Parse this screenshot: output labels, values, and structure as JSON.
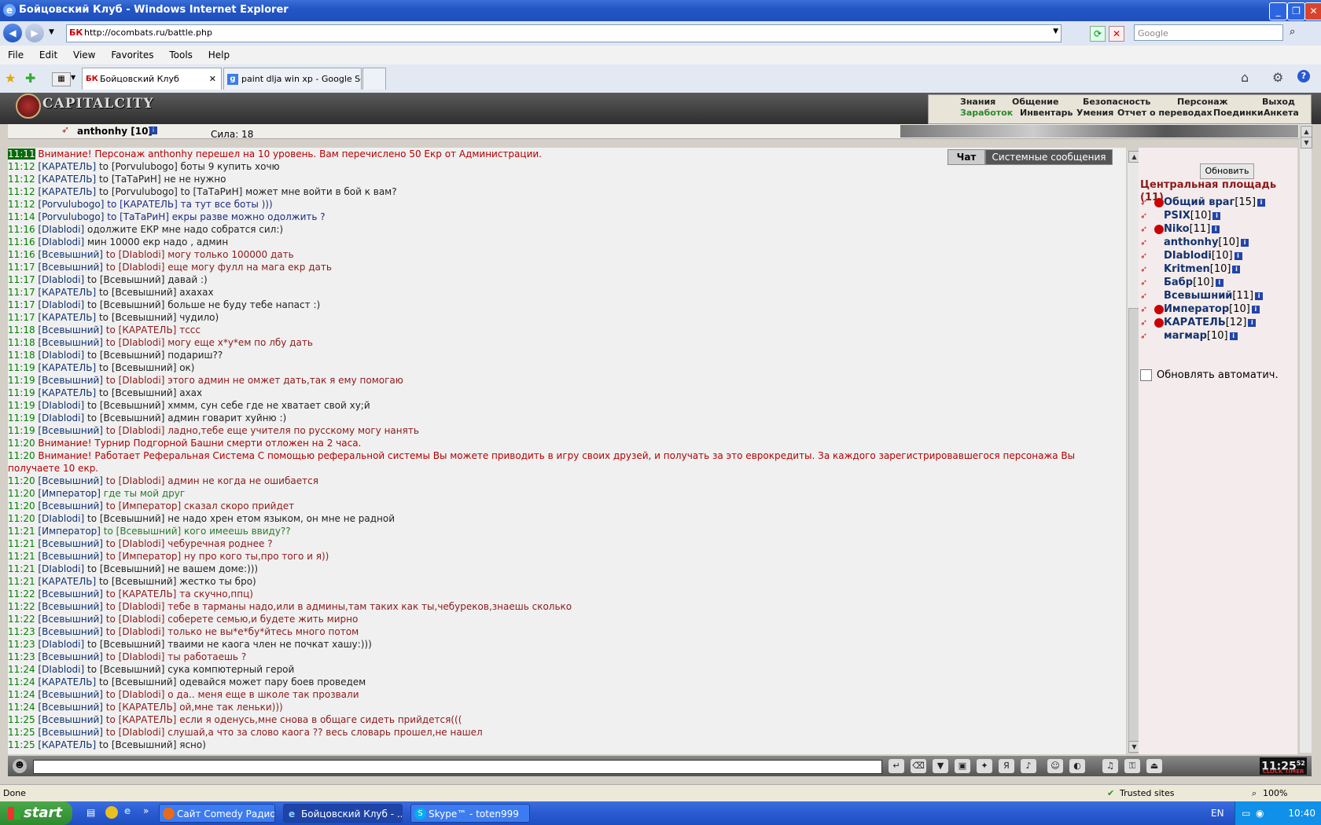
{
  "window": {
    "title": "Бойцовский Клуб - Windows Internet Explorer",
    "ie_icon": "ie-e-icon"
  },
  "address": {
    "url": "http://ocombats.ru/battle.php",
    "search_placeholder": "Google",
    "favicon": "БК"
  },
  "menu": [
    "File",
    "Edit",
    "View",
    "Favorites",
    "Tools",
    "Help"
  ],
  "tabs": [
    {
      "label": "Бойцовский Клуб",
      "icon": "БК"
    },
    {
      "label": "paint dlja win xp - Google Se...",
      "icon": "g"
    }
  ],
  "game": {
    "logo": "CAPITALCITY",
    "nav_top": [
      "Знания",
      "Общение",
      "Безопасность",
      "Персонаж",
      "Выход"
    ],
    "nav_bottom": [
      "Заработок",
      "Инвентарь",
      "Умения",
      "Отчет о переводах",
      "Поединки",
      "Анкета"
    ],
    "character": {
      "name": "anthonhy [10]",
      "stat": "Сила: 18"
    }
  },
  "chat": {
    "tab_chat": "Чат",
    "tab_system": "Системные сообщения",
    "lines": [
      {
        "time": "11:11",
        "speaker": "",
        "target": "",
        "text": "Внимание! Персонаж anthonhy перешел на 10 уровень. Вам перечислено 50 Екр от Администрации.",
        "cls": "sys",
        "hl": true
      },
      {
        "time": "11:12",
        "speaker": "[КАРАТЕЛЬ]",
        "target": "to [Porvulubogo]",
        "text": "боты 9 купить хочю",
        "cls": "to"
      },
      {
        "time": "11:12",
        "speaker": "[КАРАТЕЛЬ]",
        "target": "to [ТаТаРиН]",
        "text": "не не нужно",
        "cls": "to"
      },
      {
        "time": "11:12",
        "speaker": "[КАРАТЕЛЬ]",
        "target": "to [Porvulubogo] to [ТаТаРиН]",
        "text": "может мне войти в бой к вам?",
        "cls": "to"
      },
      {
        "time": "11:12",
        "speaker": "[Porvulubogo]",
        "target": "to [КАРАТЕЛЬ]",
        "text": "та тут все боты )))",
        "cls": "bl"
      },
      {
        "time": "11:14",
        "speaker": "[Porvulubogo]",
        "target": "to [ТаТаРиН]",
        "text": "екры разве можно одолжить ?",
        "cls": "bl"
      },
      {
        "time": "11:16",
        "speaker": "[DIablodi]",
        "target": "",
        "text": "одолжите ЕКР мне надо собратся сил:)",
        "cls": "to"
      },
      {
        "time": "11:16",
        "speaker": "[DIablodi]",
        "target": "",
        "text": "мин 10000 екр надо , админ",
        "cls": "to"
      },
      {
        "time": "11:16",
        "speaker": "[Всевышний]",
        "target": "to [DIablodi]",
        "text": "могу только 100000 дать",
        "cls": "rd"
      },
      {
        "time": "11:17",
        "speaker": "[Всевышний]",
        "target": "to [DIablodi]",
        "text": "еще могу фулл на мага екр дать",
        "cls": "rd"
      },
      {
        "time": "11:17",
        "speaker": "[DIablodi]",
        "target": "to [Всевышний]",
        "text": "давай :)",
        "cls": "to"
      },
      {
        "time": "11:17",
        "speaker": "[КАРАТЕЛЬ]",
        "target": "to [Всевышний]",
        "text": "ахахах",
        "cls": "to"
      },
      {
        "time": "11:17",
        "speaker": "[DIablodi]",
        "target": "to [Всевышний]",
        "text": "больше не буду тебе напаст :)",
        "cls": "to"
      },
      {
        "time": "11:17",
        "speaker": "[КАРАТЕЛЬ]",
        "target": "to [Всевышний]",
        "text": "чудило)",
        "cls": "to"
      },
      {
        "time": "11:18",
        "speaker": "[Всевышний]",
        "target": "to [КАРАТЕЛЬ]",
        "text": "тссс",
        "cls": "rd"
      },
      {
        "time": "11:18",
        "speaker": "[Всевышний]",
        "target": "to [DIablodi]",
        "text": "могу еще х*у*ем по лбу дать",
        "cls": "rd"
      },
      {
        "time": "11:18",
        "speaker": "[DIablodi]",
        "target": "to [Всевышний]",
        "text": "подариш??",
        "cls": "to"
      },
      {
        "time": "11:19",
        "speaker": "[КАРАТЕЛЬ]",
        "target": "to [Всевышний]",
        "text": "ок)",
        "cls": "to"
      },
      {
        "time": "11:19",
        "speaker": "[Всевышний]",
        "target": "to [DIablodi]",
        "text": "этого админ не омжет дать,так я ему помогаю",
        "cls": "rd"
      },
      {
        "time": "11:19",
        "speaker": "[КАРАТЕЛЬ]",
        "target": "to [Всевышний]",
        "text": "ахах",
        "cls": "to"
      },
      {
        "time": "11:19",
        "speaker": "[DIablodi]",
        "target": "to [Всевышний]",
        "text": "хммм, сун себе где не хватает свой ху;й",
        "cls": "to"
      },
      {
        "time": "11:19",
        "speaker": "[DIablodi]",
        "target": "to [Всевышний]",
        "text": "админ говарит хуйню :)",
        "cls": "to"
      },
      {
        "time": "11:19",
        "speaker": "[Всевышний]",
        "target": "to [DIablodi]",
        "text": "ладно,тебе еще учителя по русскому могу нанять",
        "cls": "rd"
      },
      {
        "time": "11:20",
        "speaker": "",
        "target": "",
        "text": "Внимание! Турнир Подгорной Башни смерти отложен на 2 часа.",
        "cls": "sys"
      },
      {
        "time": "11:20",
        "speaker": "",
        "target": "",
        "text": "Внимание! Работает Реферальная Система С помощью реферальной системы Вы можете приводить в игру своих друзей, и получать за это еврокредиты. За каждого зарегистрировавшегося персонажа Вы получаете 10 екр.",
        "cls": "sys",
        "wrap": true
      },
      {
        "time": "11:20",
        "speaker": "[Всевышний]",
        "target": "to [DIablodi]",
        "text": "админ не когда не ошибается",
        "cls": "rd"
      },
      {
        "time": "11:20",
        "speaker": "[Император]",
        "target": "",
        "text": "где ты мой друг",
        "cls": "gr"
      },
      {
        "time": "11:20",
        "speaker": "[Всевышний]",
        "target": "to [Император]",
        "text": "сказал скоро прийдет",
        "cls": "rd"
      },
      {
        "time": "11:20",
        "speaker": "[DIablodi]",
        "target": "to [Всевышний]",
        "text": "не надо хрен етом языком, он мне не радной",
        "cls": "to"
      },
      {
        "time": "11:21",
        "speaker": "[Император]",
        "target": "to [Всевышний]",
        "text": "кого имеешь ввиду??",
        "cls": "gr"
      },
      {
        "time": "11:21",
        "speaker": "[Всевышний]",
        "target": "to [DIablodi]",
        "text": "чебуречная роднее ?",
        "cls": "rd"
      },
      {
        "time": "11:21",
        "speaker": "[Всевышний]",
        "target": "to [Император]",
        "text": "ну про кого ты,про того и я))",
        "cls": "rd"
      },
      {
        "time": "11:21",
        "speaker": "[DIablodi]",
        "target": "to [Всевышний]",
        "text": "не вашем доме:)))",
        "cls": "to"
      },
      {
        "time": "11:21",
        "speaker": "[КАРАТЕЛЬ]",
        "target": "to [Всевышний]",
        "text": "жестко ты бро)",
        "cls": "to"
      },
      {
        "time": "11:22",
        "speaker": "[Всевышний]",
        "target": "to [КАРАТЕЛЬ]",
        "text": "та скучно,ппц)",
        "cls": "rd"
      },
      {
        "time": "11:22",
        "speaker": "[Всевышний]",
        "target": "to [DIablodi]",
        "text": "тебе в тарманы надо,или в админы,там таких как ты,чебуреков,знаешь сколько",
        "cls": "rd"
      },
      {
        "time": "11:22",
        "speaker": "[Всевышний]",
        "target": "to [DIablodi]",
        "text": "соберете семью,и будете жить мирно",
        "cls": "rd"
      },
      {
        "time": "11:23",
        "speaker": "[Всевышний]",
        "target": "to [DIablodi]",
        "text": "только не вы*е*бу*йтесь много потом",
        "cls": "rd"
      },
      {
        "time": "11:23",
        "speaker": "[DIablodi]",
        "target": "to [Всевышний]",
        "text": "тваими не каога член не почкат хашу:)))",
        "cls": "to"
      },
      {
        "time": "11:23",
        "speaker": "[Всевышний]",
        "target": "to [DIablodi]",
        "text": "ты работаешь ?",
        "cls": "rd"
      },
      {
        "time": "11:24",
        "speaker": "[DIablodi]",
        "target": "to [Всевышний]",
        "text": "сука компютерный герой",
        "cls": "to"
      },
      {
        "time": "11:24",
        "speaker": "[КАРАТЕЛЬ]",
        "target": "to [Всевышний]",
        "text": "одевайся может пару боев проведем",
        "cls": "to"
      },
      {
        "time": "11:24",
        "speaker": "[Всевышний]",
        "target": "to [DIablodi]",
        "text": "о да.. меня еще в школе так прозвали",
        "cls": "rd"
      },
      {
        "time": "11:24",
        "speaker": "[Всевышний]",
        "target": "to [КАРАТЕЛЬ]",
        "text": "ой,мне так леньки)))",
        "cls": "rd"
      },
      {
        "time": "11:25",
        "speaker": "[Всевышний]",
        "target": "to [КАРАТЕЛЬ]",
        "text": "если я оденусь,мне снова в общаге сидеть прийдется(((",
        "cls": "rd"
      },
      {
        "time": "11:25",
        "speaker": "[Всевышний]",
        "target": "to [DIablodi]",
        "text": "слушай,а что за слово каога ?? весь словарь прошел,не нашел",
        "cls": "rd"
      },
      {
        "time": "11:25",
        "speaker": "[КАРАТЕЛЬ]",
        "target": "to [Всевышний]",
        "text": "ясно)",
        "cls": "to"
      }
    ]
  },
  "side": {
    "refresh": "Обновить",
    "location": "Центральная площадь",
    "count": "(11)",
    "users": [
      {
        "name": "Общий враг",
        "level": "[15]",
        "badge": true
      },
      {
        "name": "PSIX",
        "level": "[10]",
        "badge": false
      },
      {
        "name": "Niko",
        "level": "[11]",
        "badge": true
      },
      {
        "name": "anthonhy",
        "level": "[10]",
        "badge": false
      },
      {
        "name": "DIablodi",
        "level": "[10]",
        "badge": false
      },
      {
        "name": "Kritmen",
        "level": "[10]",
        "badge": false
      },
      {
        "name": "Бабр",
        "level": "[10]",
        "badge": false
      },
      {
        "name": "Всевышний",
        "level": "[11]",
        "badge": false
      },
      {
        "name": "Император",
        "level": "[10]",
        "badge": true
      },
      {
        "name": "КАРАТЕЛЬ",
        "level": "[12]",
        "badge": true
      },
      {
        "name": "магмар",
        "level": "[10]",
        "badge": false
      }
    ],
    "auto_refresh": "Обновлять автоматич."
  },
  "clock": {
    "time": "11:25",
    "sec": "52",
    "label": "CLOCK TIMER"
  },
  "status": {
    "left": "Done",
    "zone": "Trusted sites",
    "zoom": "100%"
  },
  "taskbar": {
    "start": "start",
    "buttons": [
      "Сайт Comedy Радио ...",
      "Бойцовский Клуб - ...",
      "Skype™ - toten999"
    ],
    "lang": "EN",
    "time": "10:40"
  },
  "colors": {
    "accent": "#2456c6",
    "chat_bg": "#f0f0f0",
    "side_bg": "#f4ecec",
    "system_text": "#b50000"
  }
}
